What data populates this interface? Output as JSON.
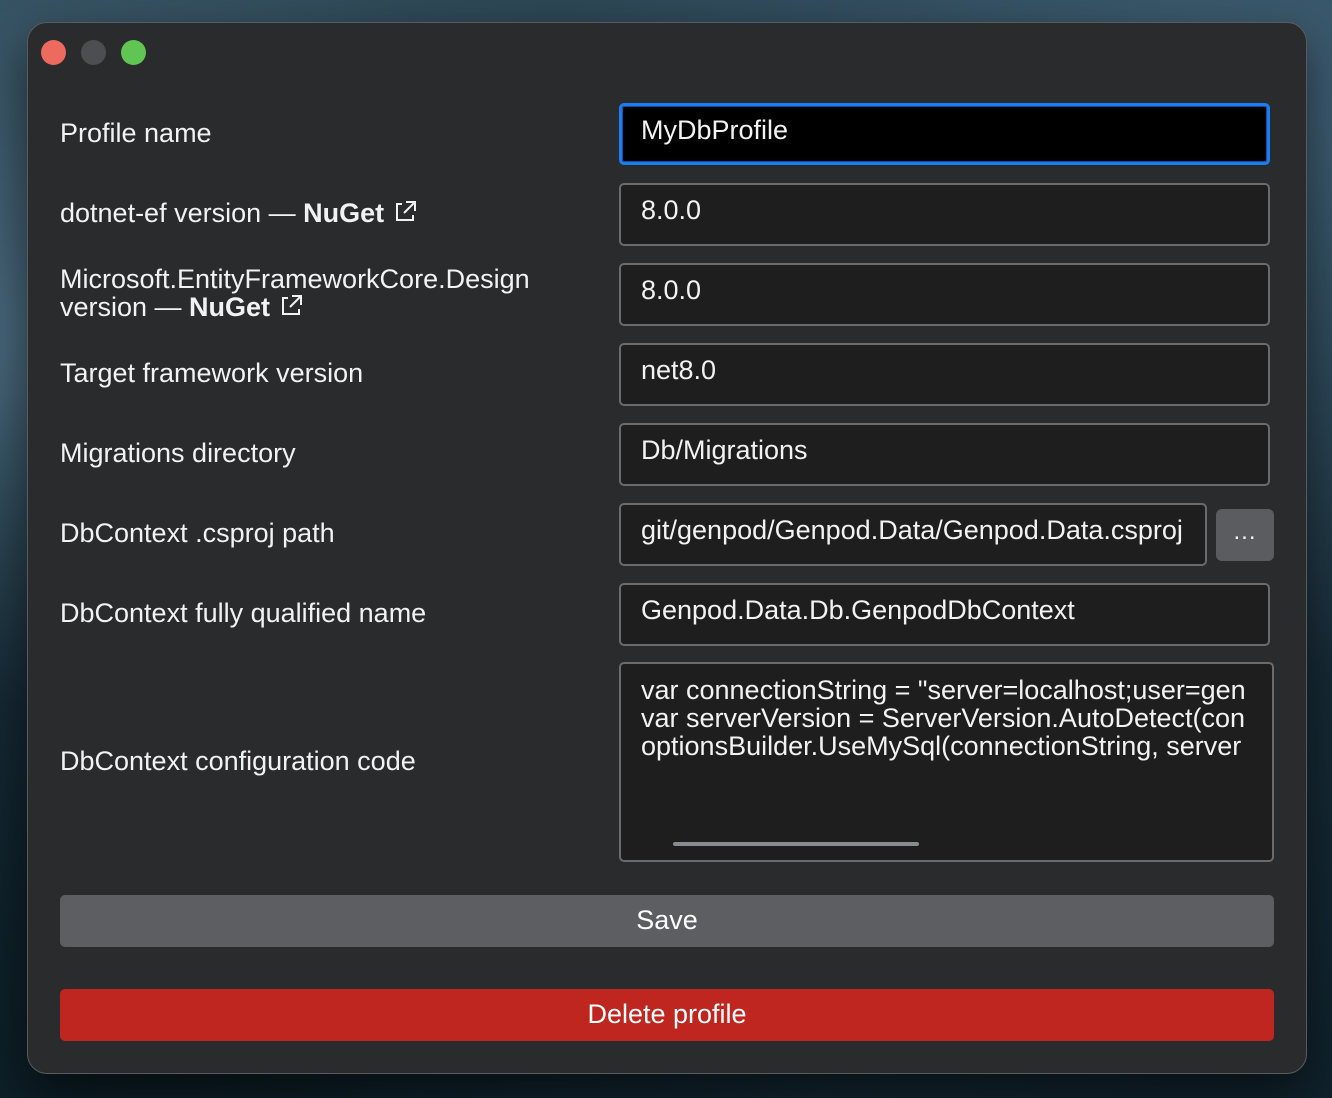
{
  "window": {
    "controls": [
      "close",
      "minimize",
      "zoom"
    ]
  },
  "form": {
    "profile_name": {
      "label": "Profile name",
      "value": "MyDbProfile"
    },
    "dotnet_ef": {
      "label_prefix": "dotnet-ef version — ",
      "link": "NuGet",
      "value": "8.0.0"
    },
    "ef_design": {
      "label_line1": "Microsoft.EntityFrameworkCore.Design",
      "label_prefix": "version — ",
      "link": "NuGet",
      "value": "8.0.0"
    },
    "target_framework": {
      "label": "Target framework version",
      "value": "net8.0"
    },
    "migrations_dir": {
      "label": "Migrations directory",
      "value": "Db/Migrations"
    },
    "csproj_path": {
      "label": "DbContext .csproj path",
      "value": "git/genpod/Genpod.Data/Genpod.Data.csproj",
      "browse_label": "..."
    },
    "fq_name": {
      "label": "DbContext fully qualified name",
      "value": "Genpod.Data.Db.GenpodDbContext"
    },
    "config_code": {
      "label": "DbContext configuration code",
      "lines": [
        "var connectionString = \"server=localhost;user=gen",
        "var serverVersion = ServerVersion.AutoDetect(con",
        "optionsBuilder.UseMySql(connectionString, server"
      ]
    }
  },
  "actions": {
    "save_label": "Save",
    "delete_label": "Delete profile"
  },
  "colors": {
    "accent": "#1a7ef0",
    "danger": "#bf261f",
    "button": "#5d5e61"
  }
}
